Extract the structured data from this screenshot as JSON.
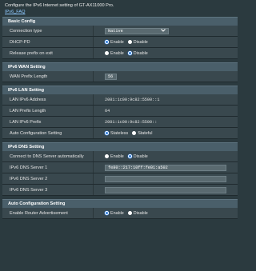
{
  "intro": {
    "description": "Configure the IPv6 Internet setting of GT-AX11000 Pro.",
    "faq_link": "IPv6_FAQ"
  },
  "basic": {
    "header": "Basic Config",
    "connection_type_label": "Connection type",
    "connection_type_value": "Native",
    "dhcp_pd_label": "DHCP-PD",
    "dhcp_pd_enable": "Enable",
    "dhcp_pd_disable": "Disable",
    "dhcp_pd_selected": "Enable",
    "release_label": "Release prefix on exit",
    "release_enable": "Enable",
    "release_disable": "Disable",
    "release_selected": "Disable"
  },
  "wan": {
    "header": "IPv6 WAN Setting",
    "prefix_length_label": "WAN Prefix Length",
    "prefix_length_value": "56"
  },
  "lan": {
    "header": "IPv6 LAN Setting",
    "address_label": "LAN IPv6 Address",
    "address_value": "2001:1c00:9c82:5500::1",
    "prefix_length_label": "LAN Prefix Length",
    "prefix_length_value": "64",
    "prefix_label": "LAN IPv6 Prefix",
    "prefix_value": "2001:1c00:9c82:5500::",
    "autoconf_label": "Auto Configuration Setting",
    "autoconf_stateless": "Stateless",
    "autoconf_stateful": "Stateful",
    "autoconf_selected": "Stateless"
  },
  "dns": {
    "header": "IPv6 DNS Setting",
    "auto_label": "Connect to DNS Server automatically",
    "auto_enable": "Enable",
    "auto_disable": "Disable",
    "auto_selected": "Disable",
    "server1_label": "IPv6 DNS Server 1",
    "server1_value": "fe80::217:10ff:fe01:a502",
    "server2_label": "IPv6 DNS Server 2",
    "server2_value": "",
    "server3_label": "IPv6 DNS Server 3",
    "server3_value": ""
  },
  "autoconf": {
    "header": "Auto Configuration Setting",
    "ra_label": "Enable Router Advertisement",
    "ra_enable": "Enable",
    "ra_disable": "Disable",
    "ra_selected": "Enable"
  },
  "colors": {
    "page_bg": "#2b3a3f",
    "section_header_bg": "#4a5f6a",
    "row_bg": "#39484e",
    "radio_selected": "#2f7fe0",
    "link": "#8fc9ff"
  },
  "icons": {
    "select_arrow": "chevron-down-icon"
  }
}
